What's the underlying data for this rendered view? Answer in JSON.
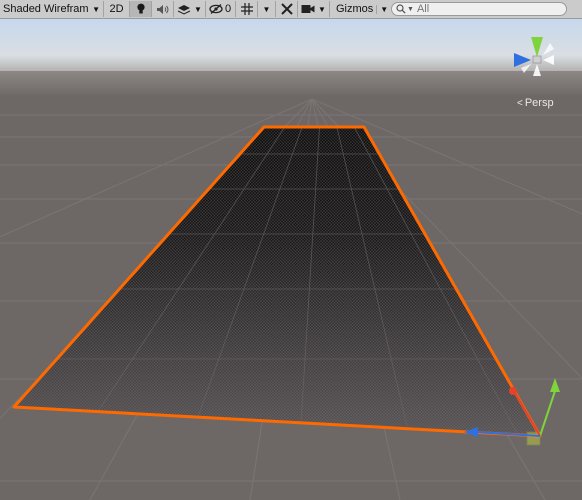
{
  "toolbar": {
    "draw_mode": "Shaded Wireframe",
    "mode_2d": "2D",
    "hidden_count": "0",
    "gizmos": "Gizmos",
    "search_placeholder": "All"
  },
  "scene": {
    "camera_label": "Persp",
    "selection_outline_color": "#ff6a00",
    "sky_color": "#c5d6ea",
    "ground_color": "#6d6866",
    "axis_colors": {
      "x": "#e5412d",
      "y": "#7fd33b",
      "z": "#2f6fe0"
    }
  }
}
